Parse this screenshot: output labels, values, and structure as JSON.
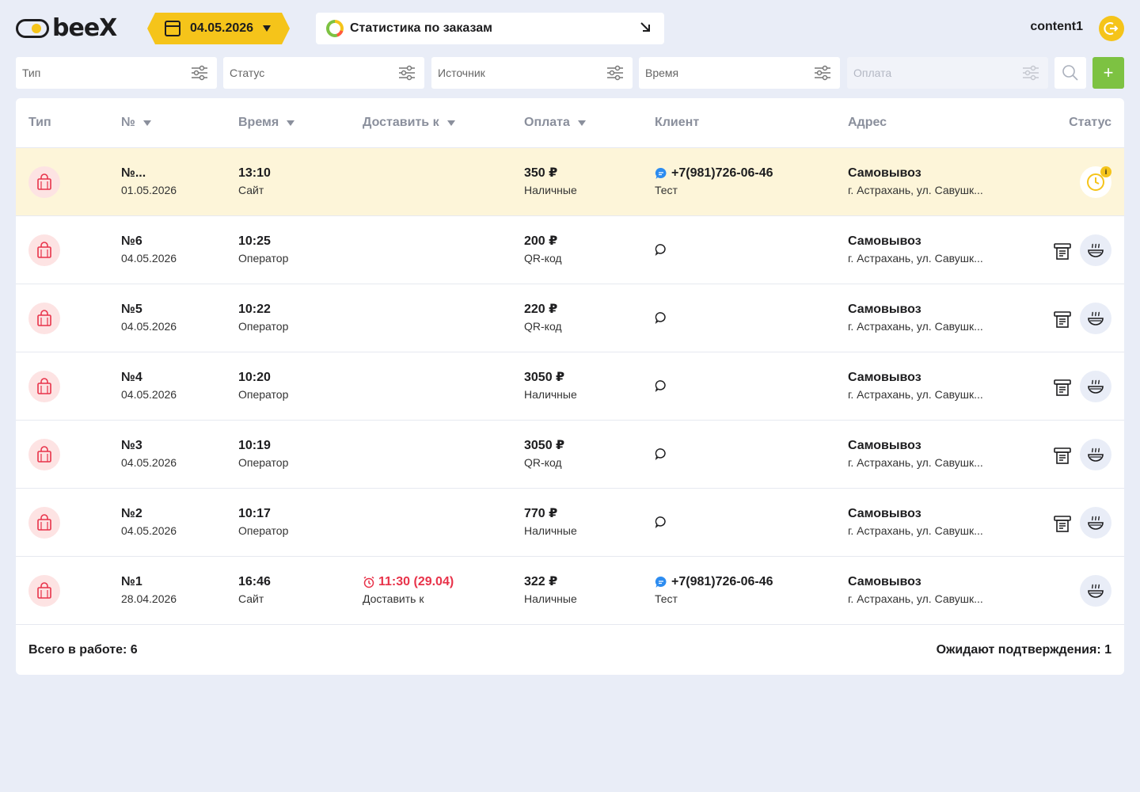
{
  "header": {
    "logo_text": "beeX",
    "date": "04.05.2026",
    "stats_label": "Статистика по заказам",
    "user": "content1"
  },
  "filters": [
    {
      "placeholder": "Тип",
      "disabled": false
    },
    {
      "placeholder": "Статус",
      "disabled": false
    },
    {
      "placeholder": "Источник",
      "disabled": false
    },
    {
      "placeholder": "Время",
      "disabled": false
    },
    {
      "placeholder": "Оплата",
      "disabled": true
    }
  ],
  "add_label": "+",
  "columns": {
    "type": "Тип",
    "num": "№",
    "time": "Время",
    "deliver": "Доставить к",
    "pay": "Оплата",
    "client": "Клиент",
    "addr": "Адрес",
    "status": "Статус"
  },
  "colors": {
    "accent": "#f5c41a",
    "add": "#7dc242",
    "highlight": "#fdf5d9",
    "deliver": "#e8334a",
    "type_icon": "#e8334a"
  },
  "orders": [
    {
      "num": "№...",
      "date": "01.05.2026",
      "time": "13:10",
      "source": "Сайт",
      "deliver_time": "",
      "deliver_label": "",
      "amount": "350 ₽",
      "method": "Наличные",
      "phone": "+7(981)726-06-46",
      "client": "Тест",
      "address_main": "Самовывоз",
      "address_sub": "г. Астрахань, ул. Савушк...",
      "status": "pending",
      "highlight": true
    },
    {
      "num": "№6",
      "date": "04.05.2026",
      "time": "10:25",
      "source": "Оператор",
      "deliver_time": "",
      "deliver_label": "",
      "amount": "200 ₽",
      "method": "QR-код",
      "phone": "",
      "client": "",
      "address_main": "Самовывоз",
      "address_sub": "г. Астрахань, ул. Савушк...",
      "status": "cooking",
      "printable": true
    },
    {
      "num": "№5",
      "date": "04.05.2026",
      "time": "10:22",
      "source": "Оператор",
      "deliver_time": "",
      "deliver_label": "",
      "amount": "220 ₽",
      "method": "QR-код",
      "phone": "",
      "client": "",
      "address_main": "Самовывоз",
      "address_sub": "г. Астрахань, ул. Савушк...",
      "status": "cooking",
      "printable": true
    },
    {
      "num": "№4",
      "date": "04.05.2026",
      "time": "10:20",
      "source": "Оператор",
      "deliver_time": "",
      "deliver_label": "",
      "amount": "3050 ₽",
      "method": "Наличные",
      "phone": "",
      "client": "",
      "address_main": "Самовывоз",
      "address_sub": "г. Астрахань, ул. Савушк...",
      "status": "cooking",
      "printable": true
    },
    {
      "num": "№3",
      "date": "04.05.2026",
      "time": "10:19",
      "source": "Оператор",
      "deliver_time": "",
      "deliver_label": "",
      "amount": "3050 ₽",
      "method": "QR-код",
      "phone": "",
      "client": "",
      "address_main": "Самовывоз",
      "address_sub": "г. Астрахань, ул. Савушк...",
      "status": "cooking",
      "printable": true
    },
    {
      "num": "№2",
      "date": "04.05.2026",
      "time": "10:17",
      "source": "Оператор",
      "deliver_time": "",
      "deliver_label": "",
      "amount": "770 ₽",
      "method": "Наличные",
      "phone": "",
      "client": "",
      "address_main": "Самовывоз",
      "address_sub": "г. Астрахань, ул. Савушк...",
      "status": "cooking",
      "printable": true
    },
    {
      "num": "№1",
      "date": "28.04.2026",
      "time": "16:46",
      "source": "Сайт",
      "deliver_time": "11:30 (29.04)",
      "deliver_label": "Доставить к",
      "amount": "322 ₽",
      "method": "Наличные",
      "phone": "+7(981)726-06-46",
      "client": "Тест",
      "address_main": "Самовывоз",
      "address_sub": "г. Астрахань, ул. Савушк...",
      "status": "cooking",
      "printable": false
    }
  ],
  "footer": {
    "total": "Всего в работе: 6",
    "awaiting": "Ожидают подтверждения: 1"
  }
}
